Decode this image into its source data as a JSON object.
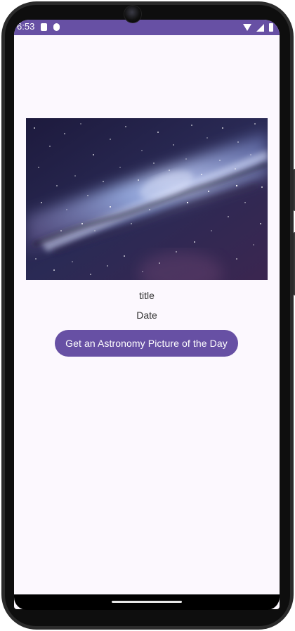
{
  "status_bar": {
    "time": "6:53",
    "icons": [
      "sim-card-icon",
      "notification-icon",
      "wifi-icon",
      "signal-icon",
      "battery-icon"
    ],
    "color": "#6750a4"
  },
  "content": {
    "image_subject": "milky-way-night-sky",
    "title": "title",
    "date": "Date",
    "button_label": "Get an Astronomy Picture of the Day"
  },
  "colors": {
    "accent": "#6750a4",
    "background": "#fcf8fe",
    "text": "#333333"
  }
}
